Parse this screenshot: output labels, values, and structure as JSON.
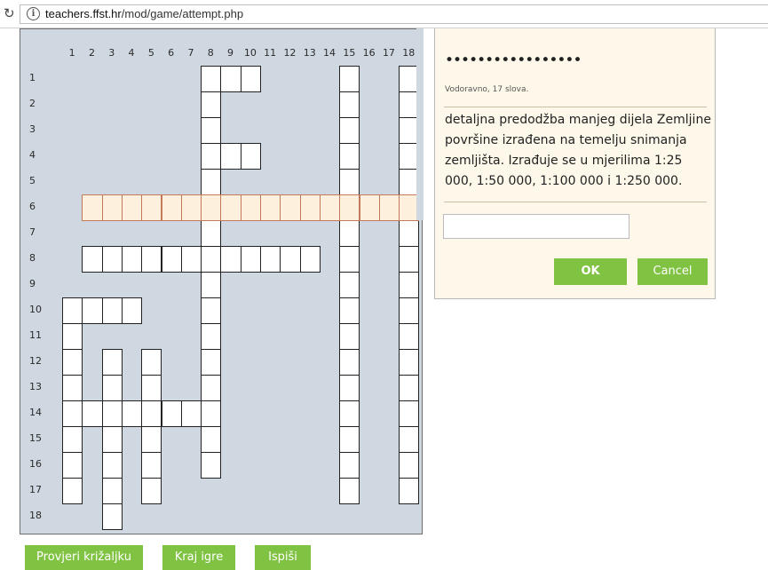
{
  "browser": {
    "url_domain": "teachers.ffst.hr",
    "url_path": "/mod/game/attempt.php"
  },
  "crossword": {
    "columns": [
      "1",
      "2",
      "3",
      "4",
      "5",
      "6",
      "7",
      "8",
      "9",
      "10",
      "11",
      "12",
      "13",
      "14",
      "15",
      "16",
      "17",
      "18"
    ],
    "rows": [
      "1",
      "2",
      "3",
      "4",
      "5",
      "6",
      "7",
      "8",
      "9",
      "10",
      "11",
      "12",
      "13",
      "14",
      "15",
      "16",
      "17",
      "18"
    ],
    "cells": [
      [
        8,
        1
      ],
      [
        9,
        1
      ],
      [
        10,
        1
      ],
      [
        15,
        1
      ],
      [
        18,
        1
      ],
      [
        8,
        2
      ],
      [
        15,
        2
      ],
      [
        18,
        2
      ],
      [
        8,
        3
      ],
      [
        15,
        3
      ],
      [
        18,
        3
      ],
      [
        8,
        4
      ],
      [
        9,
        4
      ],
      [
        10,
        4
      ],
      [
        15,
        4
      ],
      [
        18,
        4
      ],
      [
        8,
        5
      ],
      [
        15,
        5
      ],
      [
        18,
        5
      ],
      [
        8,
        7
      ],
      [
        15,
        7
      ],
      [
        18,
        7
      ],
      [
        2,
        8
      ],
      [
        3,
        8
      ],
      [
        4,
        8
      ],
      [
        5,
        8
      ],
      [
        6,
        8
      ],
      [
        7,
        8
      ],
      [
        8,
        8
      ],
      [
        9,
        8
      ],
      [
        10,
        8
      ],
      [
        11,
        8
      ],
      [
        12,
        8
      ],
      [
        13,
        8
      ],
      [
        15,
        8
      ],
      [
        18,
        8
      ],
      [
        8,
        9
      ],
      [
        15,
        9
      ],
      [
        18,
        9
      ],
      [
        1,
        10
      ],
      [
        2,
        10
      ],
      [
        3,
        10
      ],
      [
        4,
        10
      ],
      [
        8,
        10
      ],
      [
        15,
        10
      ],
      [
        18,
        10
      ],
      [
        1,
        11
      ],
      [
        8,
        11
      ],
      [
        15,
        11
      ],
      [
        18,
        11
      ],
      [
        1,
        12
      ],
      [
        3,
        12
      ],
      [
        5,
        12
      ],
      [
        8,
        12
      ],
      [
        15,
        12
      ],
      [
        18,
        12
      ],
      [
        1,
        13
      ],
      [
        3,
        13
      ],
      [
        5,
        13
      ],
      [
        8,
        13
      ],
      [
        15,
        13
      ],
      [
        18,
        13
      ],
      [
        1,
        14
      ],
      [
        2,
        14
      ],
      [
        3,
        14
      ],
      [
        4,
        14
      ],
      [
        5,
        14
      ],
      [
        6,
        14
      ],
      [
        7,
        14
      ],
      [
        8,
        14
      ],
      [
        15,
        14
      ],
      [
        18,
        14
      ],
      [
        1,
        15
      ],
      [
        3,
        15
      ],
      [
        5,
        15
      ],
      [
        8,
        15
      ],
      [
        15,
        15
      ],
      [
        18,
        15
      ],
      [
        1,
        16
      ],
      [
        3,
        16
      ],
      [
        5,
        16
      ],
      [
        8,
        16
      ],
      [
        15,
        16
      ],
      [
        18,
        16
      ],
      [
        1,
        17
      ],
      [
        3,
        17
      ],
      [
        5,
        17
      ],
      [
        15,
        17
      ],
      [
        18,
        17
      ],
      [
        3,
        18
      ]
    ],
    "highlighted_row": 6,
    "highlighted_from_col": 2,
    "highlighted_to_col": 18
  },
  "clue_panel": {
    "mask": "•••••••••••••••••",
    "meta": "Vodoravno, 17 slova.",
    "clue": "detaljna predodžba manjeg dijela Zemljine površine izrađena na temelju snimanja zemljišta. Izrađuje se u mjerilima 1:25 000, 1:50 000, 1:100 000 i 1:250 000.",
    "answer_value": "",
    "ok_label": "OK",
    "cancel_label": "Cancel"
  },
  "actions": {
    "check_label": "Provjeri križaljku",
    "end_label": "Kraj igre",
    "print_label": "Ispiši"
  },
  "colors": {
    "board_bg": "#cfd8e0",
    "highlight_bg": "#fdf0dc",
    "button_green": "#80c242",
    "panel_bg": "#fdf8e9"
  }
}
